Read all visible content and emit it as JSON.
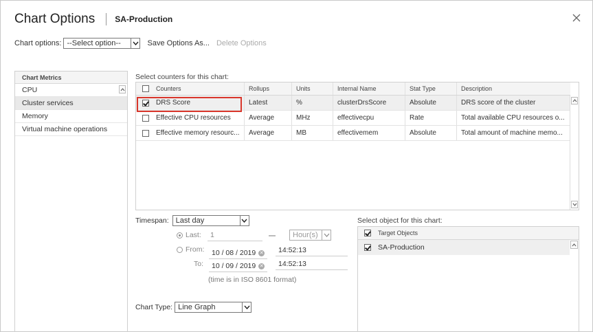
{
  "header": {
    "title": "Chart Options",
    "subtitle": "SA-Production"
  },
  "options_bar": {
    "label": "Chart options:",
    "select_value": "--Select option--",
    "save_as": "Save Options As...",
    "delete": "Delete Options"
  },
  "metrics": {
    "header": "Chart Metrics",
    "items": [
      {
        "label": "CPU",
        "selected": false
      },
      {
        "label": "Cluster services",
        "selected": true
      },
      {
        "label": "Memory",
        "selected": false
      },
      {
        "label": "Virtual machine operations",
        "selected": false
      }
    ]
  },
  "counters": {
    "label": "Select counters for this chart:",
    "columns": [
      "Counters",
      "Rollups",
      "Units",
      "Internal Name",
      "Stat Type",
      "Description"
    ],
    "rows": [
      {
        "checked": true,
        "counter": "DRS Score",
        "rollups": "Latest",
        "units": "%",
        "internal": "clusterDrsScore",
        "stat": "Absolute",
        "desc": "DRS score of the cluster"
      },
      {
        "checked": false,
        "counter": "Effective CPU resources",
        "rollups": "Average",
        "units": "MHz",
        "internal": "effectivecpu",
        "stat": "Rate",
        "desc": "Total available CPU resources o..."
      },
      {
        "checked": false,
        "counter": "Effective memory resourc...",
        "rollups": "Average",
        "units": "MB",
        "internal": "effectivemem",
        "stat": "Absolute",
        "desc": "Total amount of machine memo..."
      }
    ]
  },
  "timespan": {
    "label": "Timespan:",
    "value": "Last day",
    "last_label": "Last:",
    "last_value": "1",
    "unit": "Hour(s)",
    "from_label": "From:",
    "from_date": "10 / 08 / 2019",
    "from_time": "14:52:13",
    "to_label": "To:",
    "to_date": "10 / 09 / 2019",
    "to_time": "14:52:13",
    "note": "(time is in ISO 8601 format)"
  },
  "chart_type": {
    "label": "Chart Type:",
    "value": "Line Graph"
  },
  "objects": {
    "label": "Select object for this chart:",
    "header": "Target Objects",
    "items": [
      {
        "label": "SA-Production",
        "checked": true
      }
    ]
  }
}
